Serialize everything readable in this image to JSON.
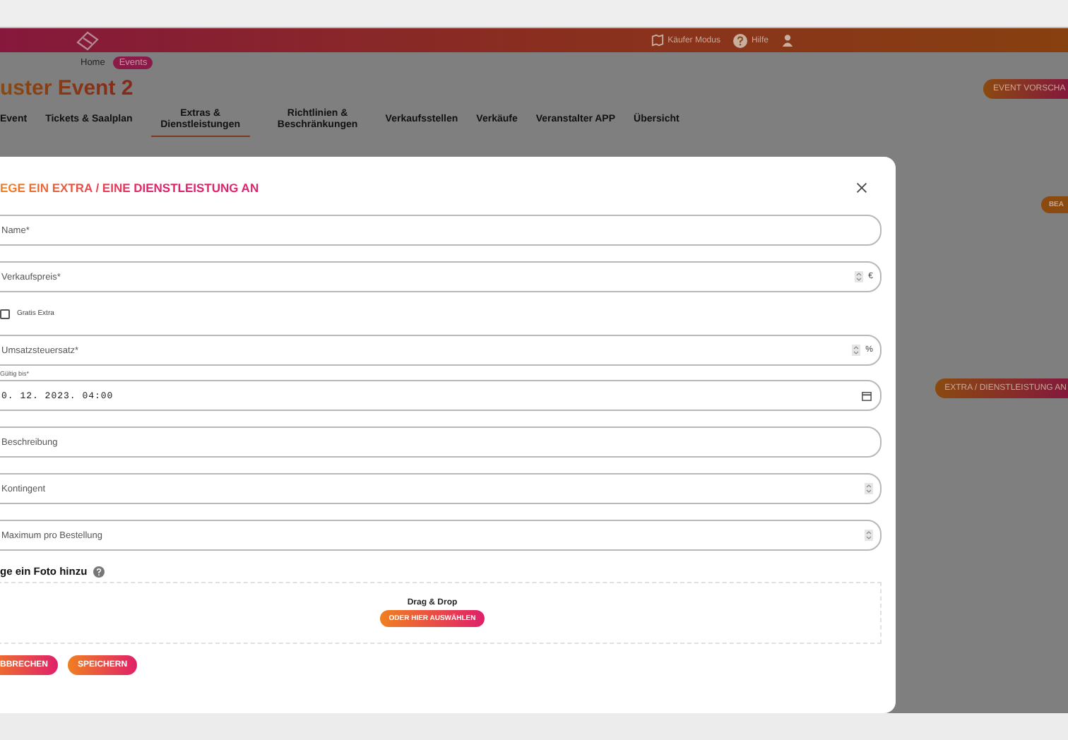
{
  "header": {
    "items": [
      {
        "kind": "map",
        "label": "Käufer Modus"
      },
      {
        "kind": "help",
        "label": "Hilfe"
      },
      {
        "kind": "user"
      }
    ]
  },
  "breadcrumb": [
    {
      "label": "Home",
      "selected": false
    },
    {
      "label": "Events",
      "selected": true
    }
  ],
  "page_title": "uster Event 2",
  "preview_button": "EVENT VORSCHA",
  "tabs": [
    {
      "label": "Event",
      "selected": false
    },
    {
      "label": "Tickets & Saalplan",
      "selected": false
    },
    {
      "label": "Extras & Dienstleistungen",
      "selected": true
    },
    {
      "label": "Richtlinien & Beschränkungen",
      "selected": false
    },
    {
      "label": "Verkaufsstellen",
      "selected": false
    },
    {
      "label": "Verkäufe",
      "selected": false
    },
    {
      "label": "Veranstalter APP",
      "selected": false
    },
    {
      "label": "Übersicht",
      "selected": false
    }
  ],
  "side_button": "BEA",
  "add_button": "EXTRA / DIENSTLEISTUNG AN",
  "modal": {
    "title": "EGE EIN EXTRA / EINE DIENSTLEISTUNG AN",
    "fields": [
      {
        "kind": "text",
        "placeholder": "Name*"
      },
      {
        "kind": "number",
        "placeholder": "Verkaufspreis*",
        "unit": "€"
      },
      {
        "kind": "checkbox",
        "label": "Gratis Extra",
        "checked": false
      },
      {
        "kind": "number",
        "placeholder": "Umsatzsteuersatz*",
        "unit": "%"
      },
      {
        "kind": "date",
        "label": "Gültig bis*",
        "value": "0. 12. 2023. 04:00"
      },
      {
        "kind": "text",
        "placeholder": "Beschreibung"
      },
      {
        "kind": "number",
        "placeholder": "Kontingent"
      },
      {
        "kind": "number",
        "placeholder": "Maximum pro Bestellung"
      }
    ],
    "photo": {
      "heading": "ge ein Foto hinzu",
      "drop_text": "Drag & Drop",
      "select_button": "ODER HIER AUSWÄHLEN"
    },
    "buttons": [
      "BBRECHEN",
      "SPEICHERN"
    ]
  }
}
